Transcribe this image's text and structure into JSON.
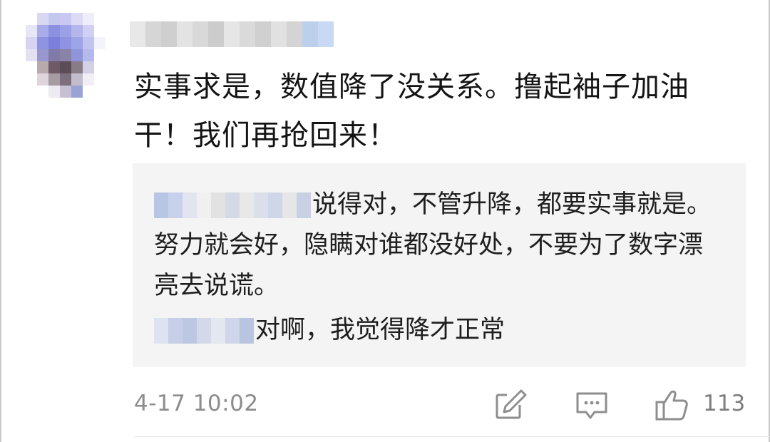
{
  "comment": {
    "avatar_icon": "avatar-pixelated",
    "username_pixel_colors": [
      "#e8e8e8",
      "#d6d6d6",
      "#cfcfcf",
      "#e3e3e3",
      "#d9d9d9",
      "#cccccc",
      "#e6e6e6",
      "#dadada",
      "#d0d0d0",
      "#e1e1e1",
      "#d4d4d4",
      "#bcd0ee",
      "#c9d8f3"
    ],
    "avatar_pixel_colors": [
      "#ffffff",
      "#d8d8f2",
      "#c4c8ee",
      "#c9c8f0",
      "#dcdaf5",
      "#eeeefb",
      "#ffffff",
      "#e7e6f7",
      "#a8acea",
      "#8b90e0",
      "#9ca0e6",
      "#b4b6ec",
      "#cfd0f3",
      "#ffffff",
      "#d6d4f3",
      "#8f94e2",
      "#7c80da",
      "#8e92e0",
      "#9ea4e8",
      "#c0c4ef",
      "#f3f3fb",
      "#e3e1f2",
      "#9897cf",
      "#7f7aa7",
      "#8a83a8",
      "#8e95d9",
      "#b5baec",
      "#ffffff",
      "#ffffff",
      "#b8a9ad",
      "#6d5a66",
      "#5c4c58",
      "#8a7c87",
      "#d3d1e6",
      "#ffffff",
      "#ffffff",
      "#ded6dc",
      "#a79ba3",
      "#7d6f7d",
      "#c2bccb",
      "#f1eff5",
      "#ffffff",
      "#ffffff",
      "#ffffff",
      "#eeeaf1",
      "#c7c0d2",
      "#9aa3d6",
      "#ffffff",
      "#ffffff"
    ],
    "text": "实事求是，数值降了没关系。撸起袖子加油干！我们再抢回来！"
  },
  "replies": [
    {
      "author_pixel_colors": [
        "#b8c6e6",
        "#c7d1ec",
        "#e1e5f0",
        "#f0f0f0",
        "#e2e2e2",
        "#d5d9e5",
        "#e8e8e8",
        "#dadfea",
        "#cfd6e9",
        "#e6e6e6",
        "#c9d0e4"
      ],
      "text": "说得对，不管升降，都要实事就是。努力就会好，隐瞒对谁都没好处，不要为了数字漂亮去说谎。"
    },
    {
      "author_pixel_colors": [
        "#dde3f1",
        "#c6cfe6",
        "#bcc7e2",
        "#d3d9ea",
        "#e4e7ef",
        "#cfd6ea",
        "#b9c4e0"
      ],
      "text": "对啊，我觉得降才正常"
    }
  ],
  "footer": {
    "timestamp": "4-17 10:02",
    "edit_icon": "edit-icon",
    "comment_icon": "comment-icon",
    "like_icon": "thumbs-up-icon",
    "like_count": "113"
  }
}
